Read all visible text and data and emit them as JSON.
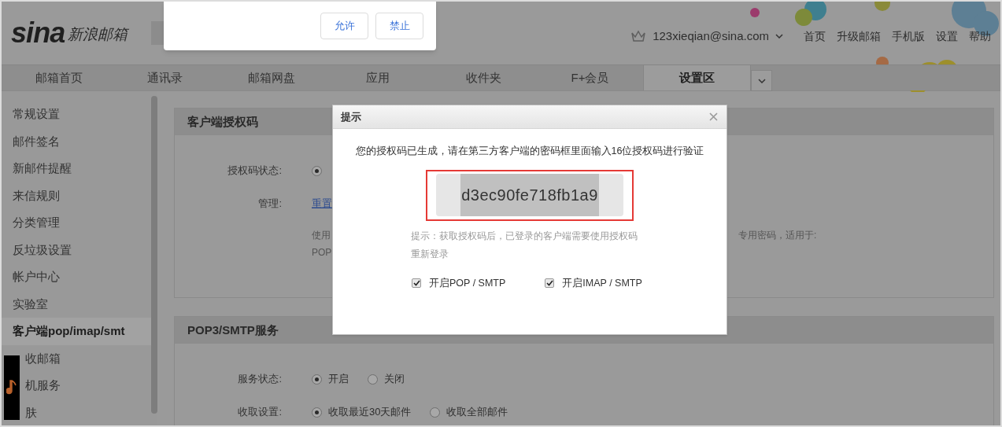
{
  "permission_prompt": {
    "buttons": [
      "允许",
      "禁止"
    ]
  },
  "header": {
    "logo_wordmark": "sina",
    "logo_text": "新浪邮箱",
    "account": "123xieqian@sina.com",
    "links": [
      "首页",
      "升级邮箱",
      "手机版",
      "设置",
      "帮助"
    ]
  },
  "tabs": [
    {
      "label": "邮箱首页",
      "selected": false
    },
    {
      "label": "通讯录",
      "selected": false
    },
    {
      "label": "邮箱网盘",
      "selected": false
    },
    {
      "label": "应用",
      "selected": false
    },
    {
      "label": "收件夹",
      "selected": false
    },
    {
      "label": "F+会员",
      "selected": false
    },
    {
      "label": "设置区",
      "selected": true
    }
  ],
  "sidebar": {
    "items": [
      {
        "label": "常规设置",
        "selected": false
      },
      {
        "label": "邮件签名",
        "selected": false
      },
      {
        "label": "新邮件提醒",
        "selected": false
      },
      {
        "label": "来信规则",
        "selected": false
      },
      {
        "label": "分类管理",
        "selected": false
      },
      {
        "label": "反垃圾设置",
        "selected": false
      },
      {
        "label": "帐户中心",
        "selected": false
      },
      {
        "label": "实验室",
        "selected": false
      },
      {
        "label": "客户端pop/imap/smt",
        "selected": true
      },
      {
        "label": "收邮箱",
        "selected": false,
        "partly_covered": true
      },
      {
        "label": "机服务",
        "selected": false,
        "partly_covered": true
      },
      {
        "label": "肤",
        "selected": false,
        "partly_covered": true
      }
    ]
  },
  "sections": [
    {
      "title": "客户端授权码",
      "rows": [
        {
          "kind": "radio",
          "label": "授权码状态:",
          "options": [
            {
              "selected": true
            }
          ]
        },
        {
          "kind": "link",
          "label": "管理:",
          "value": "重置"
        },
        {
          "kind": "note",
          "left_lines": [
            "使用",
            "POP"
          ],
          "right_text": "专用密码，适用于:"
        }
      ]
    },
    {
      "title": "POP3/SMTP服务",
      "rows": [
        {
          "kind": "radio",
          "label": "服务状态:",
          "options": [
            {
              "label": "开启",
              "selected": true
            },
            {
              "label": "关闭",
              "selected": false
            }
          ]
        },
        {
          "kind": "radio",
          "label": "收取设置:",
          "options": [
            {
              "label": "收取最近30天邮件",
              "selected": true
            },
            {
              "label": "收取全部邮件",
              "selected": false
            }
          ]
        }
      ]
    }
  ],
  "dialog": {
    "title": "提示",
    "message": "您的授权码已生成，请在第三方客户端的密码框里面输入16位授权码进行验证",
    "code": "d3ec90fe718fb1a9",
    "hint": "提示：获取授权码后，已登录的客户端需要使用授权码重新登录",
    "options": [
      {
        "label": "开启POP / SMTP",
        "checked": true
      },
      {
        "label": "开启IMAP / SMTP",
        "checked": true
      }
    ]
  }
}
